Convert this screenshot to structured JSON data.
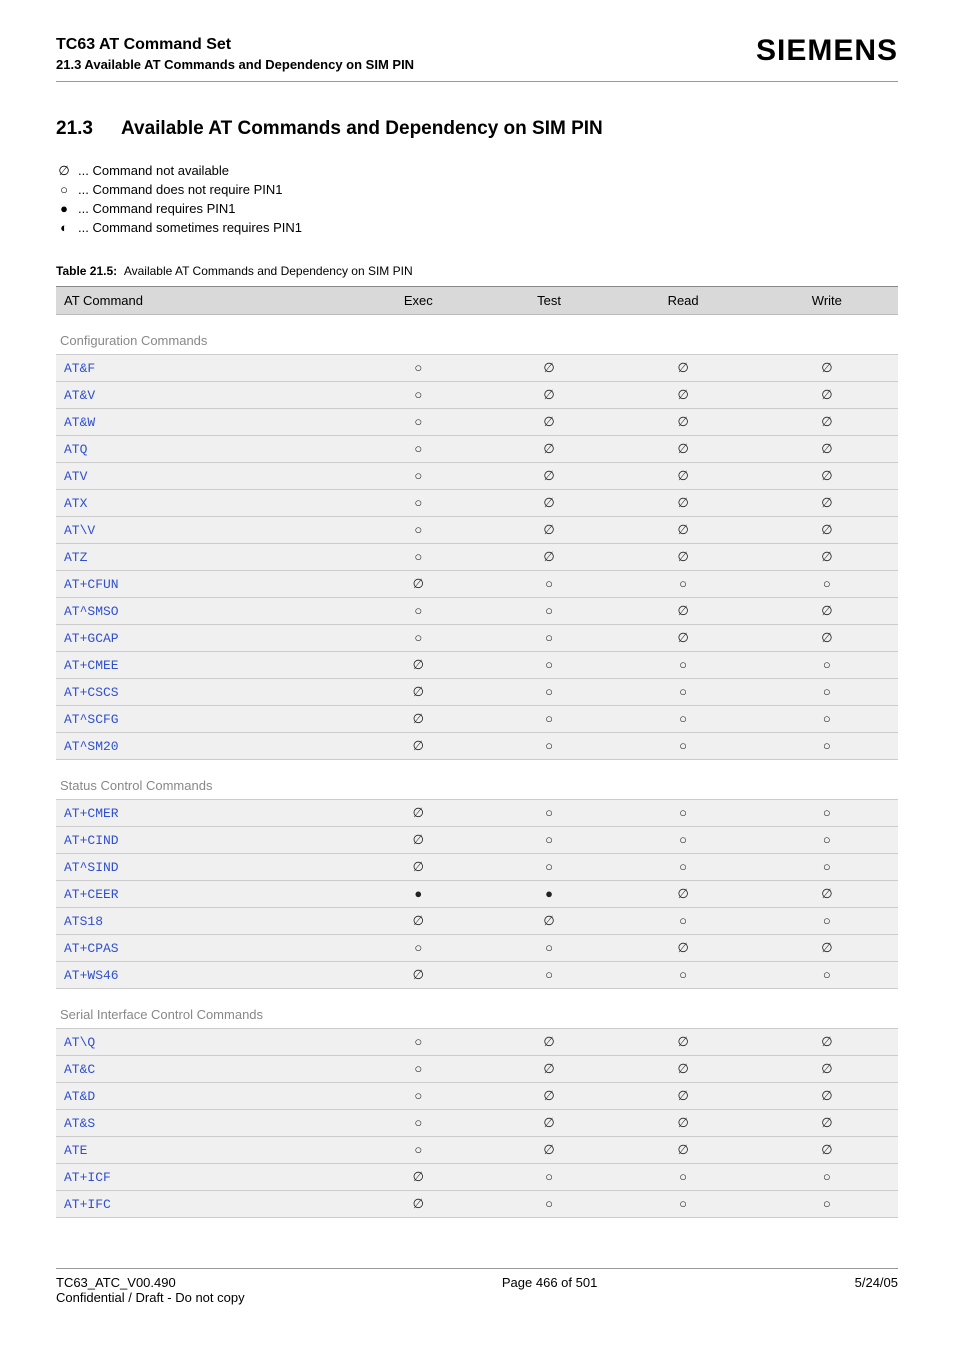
{
  "header": {
    "title": "TC63 AT Command Set",
    "subtitle": "21.3 Available AT Commands and Dependency on SIM PIN",
    "brand": "SIEMENS"
  },
  "section": {
    "number": "21.3",
    "title": "Available AT Commands and Dependency on SIM PIN"
  },
  "legend": [
    {
      "sym": "∅",
      "text": "... Command not available"
    },
    {
      "sym": "○",
      "text": "... Command does not require PIN1"
    },
    {
      "sym": "●",
      "text": "... Command requires PIN1"
    },
    {
      "sym": "◐",
      "text": "... Command sometimes requires PIN1"
    }
  ],
  "table": {
    "caption_label": "Table 21.5:",
    "caption_text": "Available AT Commands and Dependency on SIM PIN",
    "columns": [
      "AT Command",
      "Exec",
      "Test",
      "Read",
      "Write"
    ],
    "sections": [
      {
        "title": "Configuration Commands",
        "rows": [
          {
            "cmd": "AT&F",
            "exec": "○",
            "test": "∅",
            "read": "∅",
            "write": "∅"
          },
          {
            "cmd": "AT&V",
            "exec": "○",
            "test": "∅",
            "read": "∅",
            "write": "∅"
          },
          {
            "cmd": "AT&W",
            "exec": "○",
            "test": "∅",
            "read": "∅",
            "write": "∅"
          },
          {
            "cmd": "ATQ",
            "exec": "○",
            "test": "∅",
            "read": "∅",
            "write": "∅"
          },
          {
            "cmd": "ATV",
            "exec": "○",
            "test": "∅",
            "read": "∅",
            "write": "∅"
          },
          {
            "cmd": "ATX",
            "exec": "○",
            "test": "∅",
            "read": "∅",
            "write": "∅"
          },
          {
            "cmd": "AT\\V",
            "exec": "○",
            "test": "∅",
            "read": "∅",
            "write": "∅"
          },
          {
            "cmd": "ATZ",
            "exec": "○",
            "test": "∅",
            "read": "∅",
            "write": "∅"
          },
          {
            "cmd": "AT+CFUN",
            "exec": "∅",
            "test": "○",
            "read": "○",
            "write": "○"
          },
          {
            "cmd": "AT^SMSO",
            "exec": "○",
            "test": "○",
            "read": "∅",
            "write": "∅"
          },
          {
            "cmd": "AT+GCAP",
            "exec": "○",
            "test": "○",
            "read": "∅",
            "write": "∅"
          },
          {
            "cmd": "AT+CMEE",
            "exec": "∅",
            "test": "○",
            "read": "○",
            "write": "○"
          },
          {
            "cmd": "AT+CSCS",
            "exec": "∅",
            "test": "○",
            "read": "○",
            "write": "○"
          },
          {
            "cmd": "AT^SCFG",
            "exec": "∅",
            "test": "○",
            "read": "○",
            "write": "○"
          },
          {
            "cmd": "AT^SM20",
            "exec": "∅",
            "test": "○",
            "read": "○",
            "write": "○"
          }
        ]
      },
      {
        "title": "Status Control Commands",
        "rows": [
          {
            "cmd": "AT+CMER",
            "exec": "∅",
            "test": "○",
            "read": "○",
            "write": "○"
          },
          {
            "cmd": "AT+CIND",
            "exec": "∅",
            "test": "○",
            "read": "○",
            "write": "○"
          },
          {
            "cmd": "AT^SIND",
            "exec": "∅",
            "test": "○",
            "read": "○",
            "write": "○"
          },
          {
            "cmd": "AT+CEER",
            "exec": "●",
            "test": "●",
            "read": "∅",
            "write": "∅"
          },
          {
            "cmd": "ATS18",
            "exec": "∅",
            "test": "∅",
            "read": "○",
            "write": "○"
          },
          {
            "cmd": "AT+CPAS",
            "exec": "○",
            "test": "○",
            "read": "∅",
            "write": "∅"
          },
          {
            "cmd": "AT+WS46",
            "exec": "∅",
            "test": "○",
            "read": "○",
            "write": "○"
          }
        ]
      },
      {
        "title": "Serial Interface Control Commands",
        "rows": [
          {
            "cmd": "AT\\Q",
            "exec": "○",
            "test": "∅",
            "read": "∅",
            "write": "∅"
          },
          {
            "cmd": "AT&C",
            "exec": "○",
            "test": "∅",
            "read": "∅",
            "write": "∅"
          },
          {
            "cmd": "AT&D",
            "exec": "○",
            "test": "∅",
            "read": "∅",
            "write": "∅"
          },
          {
            "cmd": "AT&S",
            "exec": "○",
            "test": "∅",
            "read": "∅",
            "write": "∅"
          },
          {
            "cmd": "ATE",
            "exec": "○",
            "test": "∅",
            "read": "∅",
            "write": "∅"
          },
          {
            "cmd": "AT+ICF",
            "exec": "∅",
            "test": "○",
            "read": "○",
            "write": "○"
          },
          {
            "cmd": "AT+IFC",
            "exec": "∅",
            "test": "○",
            "read": "○",
            "write": "○"
          }
        ]
      }
    ]
  },
  "footer": {
    "left_line1": "TC63_ATC_V00.490",
    "left_line2": "Confidential / Draft - Do not copy",
    "center": "Page 466 of 501",
    "right": "5/24/05"
  }
}
